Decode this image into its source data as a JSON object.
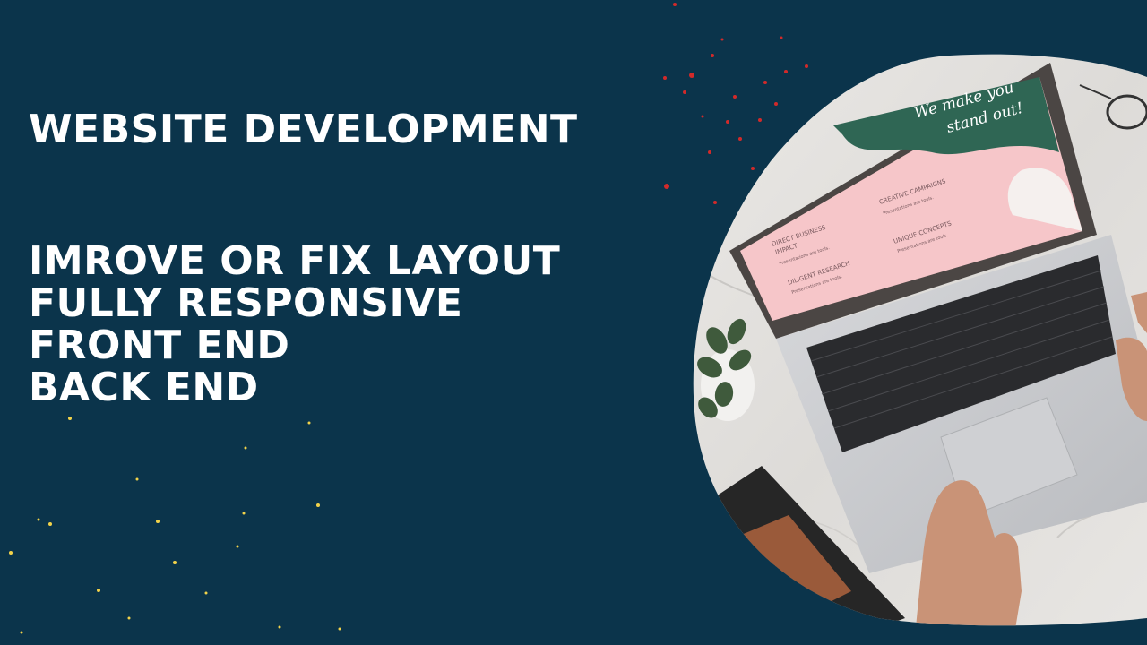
{
  "heading": "WEBSITE DEVELOPMENT",
  "services": [
    "IMROVE OR FIX LAYOUT",
    "FULLY RESPONSIVE",
    "FRONT END",
    "BACK END"
  ],
  "screen_slide": {
    "script_text_line1": "We make you",
    "script_text_line2": "stand out!",
    "items": [
      {
        "title": "DIRECT BUSINESS",
        "title2": "IMPACT",
        "sub": "Presentations are tools."
      },
      {
        "title": "CREATIVE CAMPAIGNS",
        "sub": "Presentations are tools."
      },
      {
        "title": "DILIGENT RESEARCH",
        "sub": "Presentations are tools."
      },
      {
        "title": "UNIQUE CONCEPTS",
        "sub": "Presentations are tools."
      }
    ]
  },
  "colors": {
    "background": "#0b344b",
    "text": "#ffffff",
    "confetti_red": "#d22a2a",
    "confetti_yellow": "#f2d24a",
    "slide_pink": "#f6c6c9",
    "slide_green": "#2f6654"
  }
}
